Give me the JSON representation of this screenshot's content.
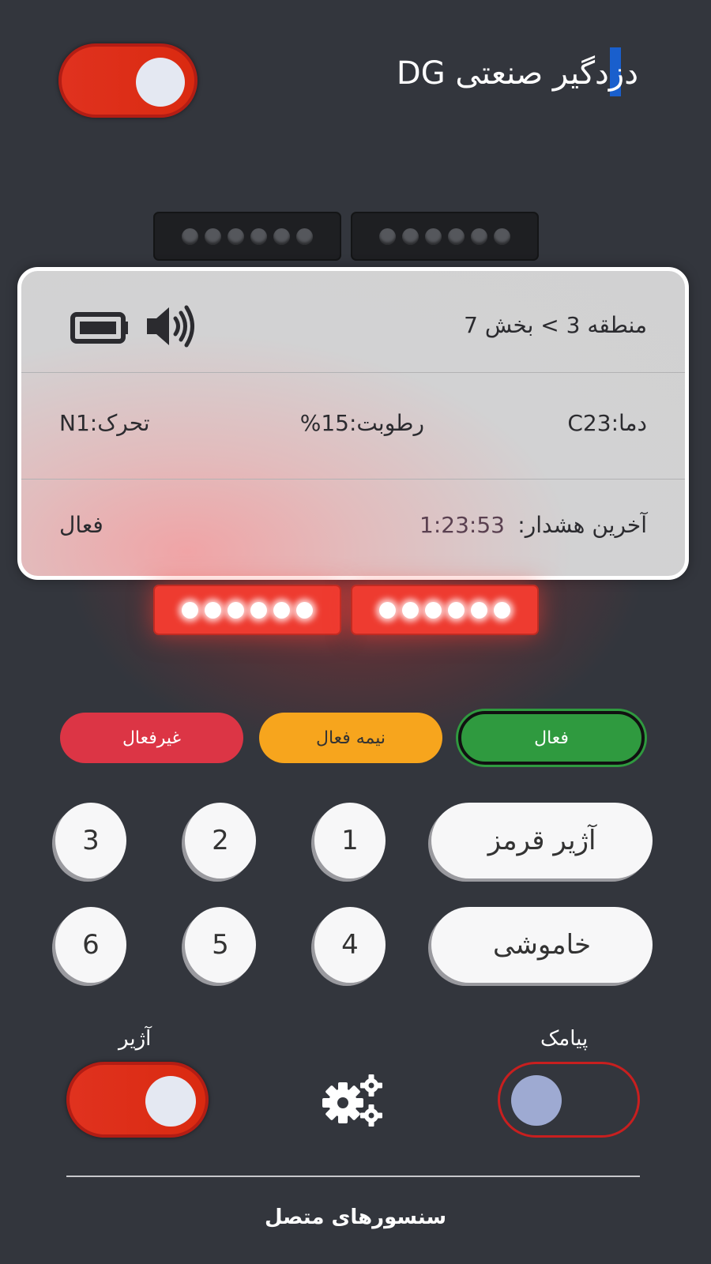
{
  "header": {
    "title": "دزدگیر صنعتی DG",
    "power_toggle": "on"
  },
  "panel": {
    "location": "منطقه 3 > بخش 7",
    "icons": [
      "battery-icon",
      "speaker-icon"
    ],
    "temperature": "دما:C23",
    "humidity": "رطوبت:15%",
    "motion": "تحرک:N1",
    "last_alarm_label": "آخرین هشدار:",
    "last_alarm_time": "1:23:53",
    "status": "فعال"
  },
  "led_bars": {
    "top": "off",
    "bottom": "on"
  },
  "modes": {
    "active": "فعال",
    "half": "نیمه فعال",
    "inactive": "غیرفعال"
  },
  "keypad": {
    "keys": [
      "1",
      "2",
      "3",
      "4",
      "5",
      "6"
    ],
    "red_siren": "آژیر قرمز",
    "silence": "خاموشی"
  },
  "controls": {
    "sms_label": "پیامک",
    "sms_toggle": "off",
    "siren_label": "آژیر",
    "siren_toggle": "on"
  },
  "footer": {
    "title": "سنسورهای متصل"
  },
  "colors": {
    "background": "#33363d",
    "active": "#2f9a3f",
    "half": "#f7a51d",
    "inactive": "#dc3545",
    "toggle_on": "#e0321f"
  }
}
